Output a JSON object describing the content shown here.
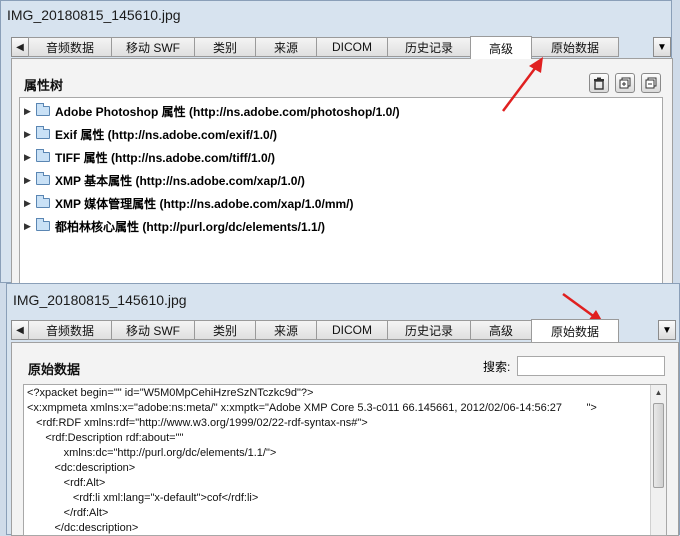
{
  "window_top": {
    "title": "IMG_20180815_145610.jpg",
    "tabs": [
      "音频数据",
      "移动 SWF",
      "类别",
      "来源",
      "DICOM",
      "历史记录",
      "高级",
      "原始数据"
    ],
    "active_tab": "高级",
    "section_title": "属性树",
    "toolbar_icons": [
      "trash-icon",
      "expand-all-icon",
      "collapse-all-icon"
    ],
    "tree_items": [
      "Adobe Photoshop 属性 (http://ns.adobe.com/photoshop/1.0/)",
      "Exif 属性 (http://ns.adobe.com/exif/1.0/)",
      "TIFF 属性 (http://ns.adobe.com/tiff/1.0/)",
      "XMP 基本属性 (http://ns.adobe.com/xap/1.0/)",
      "XMP 媒体管理属性 (http://ns.adobe.com/xap/1.0/mm/)",
      "都柏林核心属性 (http://purl.org/dc/elements/1.1/)"
    ]
  },
  "window_bottom": {
    "title": "IMG_20180815_145610.jpg",
    "tabs": [
      "音频数据",
      "移动 SWF",
      "类别",
      "来源",
      "DICOM",
      "历史记录",
      "高级",
      "原始数据"
    ],
    "active_tab": "原始数据",
    "section_title": "原始数据",
    "search_label": "搜索:",
    "search_value": "",
    "raw_lines": [
      "<?xpacket begin=\"\" id=\"W5M0MpCehiHzreSzNTczkc9d\"?>",
      "<x:xmpmeta xmlns:x=\"adobe:ns:meta/\" x:xmptk=\"Adobe XMP Core 5.3-c011 66.145661, 2012/02/06-14:56:27        \">",
      "   <rdf:RDF xmlns:rdf=\"http://www.w3.org/1999/02/22-rdf-syntax-ns#\">",
      "      <rdf:Description rdf:about=\"\"",
      "            xmlns:dc=\"http://purl.org/dc/elements/1.1/\">",
      "         <dc:description>",
      "            <rdf:Alt>",
      "               <rdf:li xml:lang=\"x-default\">cof</rdf:li>",
      "            </rdf:Alt>",
      "         </dc:description>"
    ]
  },
  "accent_color": "#e02020"
}
